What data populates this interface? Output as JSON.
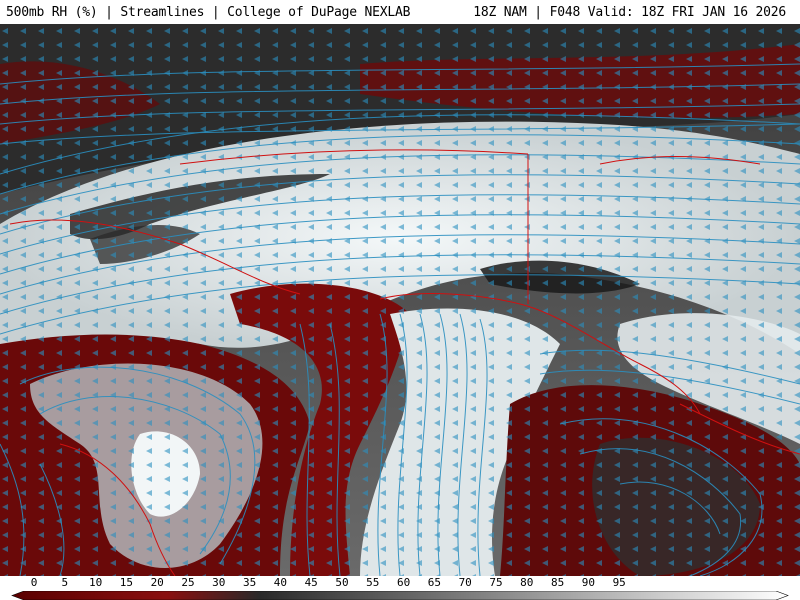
{
  "header": {
    "left_title": "500mb RH (%) | Streamlines | College of DuPage NEXLAB",
    "right_title": "18Z NAM | F048 Valid: 18Z FRI JAN 16 2026"
  },
  "legend": {
    "ticks": [
      "0",
      "5",
      "10",
      "15",
      "20",
      "25",
      "30",
      "35",
      "40",
      "45",
      "50",
      "55",
      "60",
      "65",
      "70",
      "75",
      "80",
      "85",
      "90",
      "95"
    ],
    "colors": {
      "dry": "#7a0a0a",
      "mid": "#5a5a5a",
      "moist": "#e8eef0"
    }
  },
  "map": {
    "streamline_color": "#2a8fc0",
    "border_color": "#d01010"
  }
}
